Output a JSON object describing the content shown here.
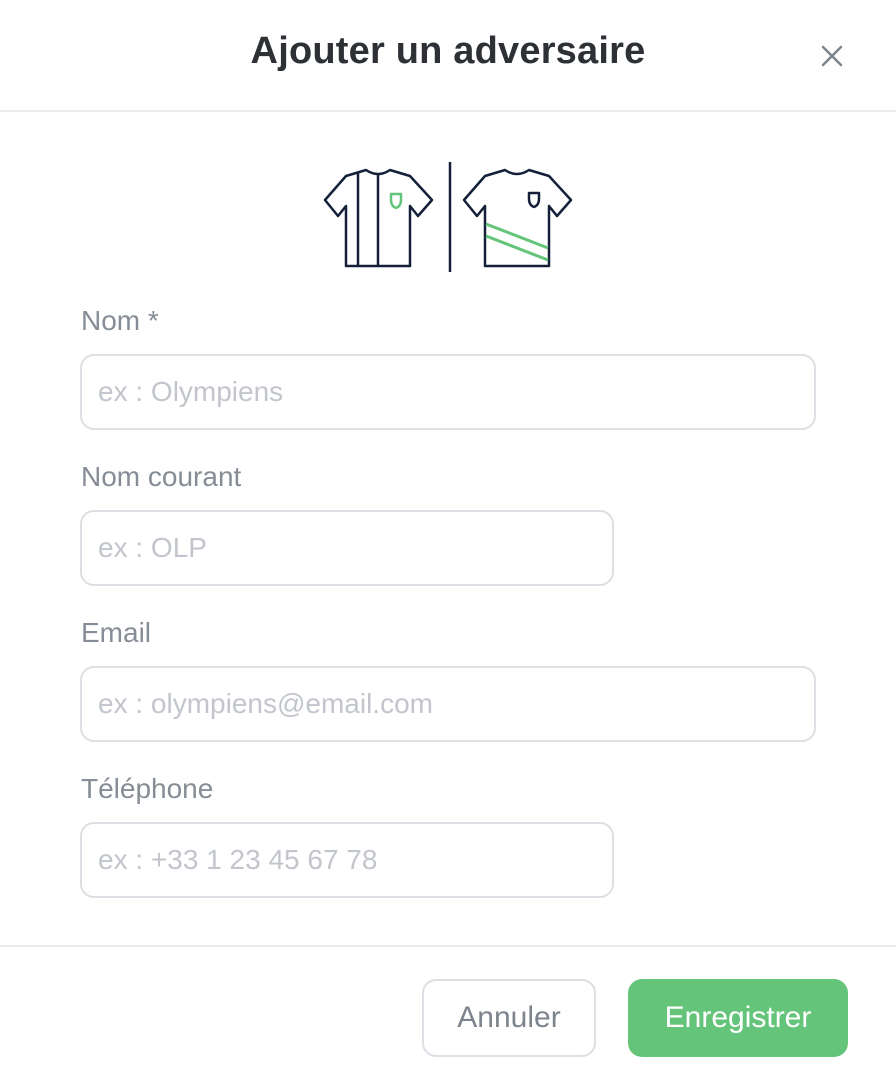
{
  "modal": {
    "title": "Ajouter un adversaire",
    "close_icon": "close-icon"
  },
  "jerseys": {
    "home_icon": "striped-jersey-icon",
    "away_icon": "sash-jersey-icon",
    "outline_color": "#14203a",
    "accent_color": "#64c47a"
  },
  "form": {
    "name_label": "Nom *",
    "name_placeholder": "ex : Olympiens",
    "short_name_label": "Nom courant",
    "short_name_placeholder": "ex : OLP",
    "email_label": "Email",
    "email_placeholder": "ex : olympiens@email.com",
    "phone_label": "Téléphone",
    "phone_placeholder": "ex : +33 1 23 45 67 78"
  },
  "footer": {
    "cancel_label": "Annuler",
    "save_label": "Enregistrer"
  },
  "colors": {
    "primary": "#64c47a",
    "title_text": "#2d3136",
    "label_text": "#868d96",
    "border": "#dcdfe3"
  }
}
